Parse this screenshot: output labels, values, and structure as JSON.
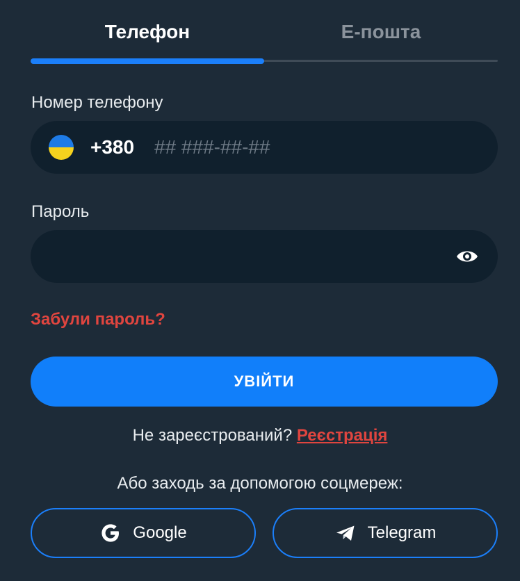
{
  "tabs": [
    {
      "label": "Телефон",
      "active": true
    },
    {
      "label": "E-пошта",
      "active": false
    }
  ],
  "phone": {
    "label": "Номер телефону",
    "flag": "ukraine-flag-icon",
    "country_code": "+380",
    "placeholder": "## ###-##-##",
    "value": ""
  },
  "password": {
    "label": "Пароль",
    "value": "",
    "toggle_icon": "eye-icon"
  },
  "forgot_link": "Забули пароль?",
  "login_button": "УВІЙТИ",
  "register": {
    "prompt": "Не зареєстрований?",
    "link": "Реєстрація"
  },
  "social": {
    "caption": "Або заходь за допомогою соцмереж:",
    "google_label": "Google",
    "telegram_label": "Telegram"
  },
  "colors": {
    "background": "#1d2b38",
    "field": "#10202d",
    "accent": "#117ffa",
    "danger": "#e0453f"
  }
}
